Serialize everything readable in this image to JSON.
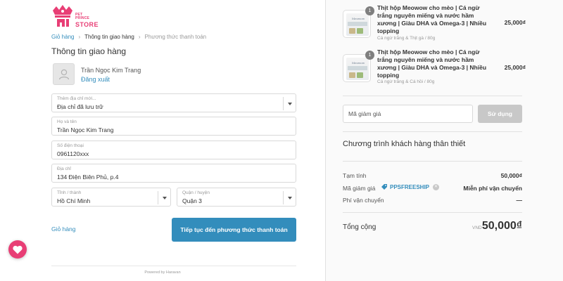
{
  "logo": {
    "line1": "PET",
    "line2": "PRINCE",
    "line3": "STORE"
  },
  "breadcrumb": {
    "cart": "Giỏ hàng",
    "shipping_info": "Thông tin giao hàng",
    "payment_method": "Phương thức thanh toán"
  },
  "section_title": "Thông tin giao hàng",
  "user": {
    "name": "Trần Ngọc Kim Trang",
    "logout": "Đăng xuất"
  },
  "fields": {
    "address_select": {
      "label": "Thêm địa chỉ mới...",
      "value": "Địa chỉ đã lưu trữ"
    },
    "fullname": {
      "label": "Họ và tên",
      "value": "Trần Ngọc Kim Trang"
    },
    "phone": {
      "label": "Số điện thoại",
      "value": "0961120xxx"
    },
    "address": {
      "label": "Địa chỉ",
      "value": "134 Điện Biên Phủ, p.4"
    },
    "province": {
      "label": "Tỉnh / thành",
      "value": "Hồ Chí Minh"
    },
    "district": {
      "label": "Quận / huyện",
      "value": "Quận 3"
    }
  },
  "actions": {
    "back_to_cart": "Giỏ hàng",
    "continue": "Tiếp tục đến phương thức thanh toán"
  },
  "footer": {
    "powered": "Powered by Haravan"
  },
  "products": [
    {
      "qty": "1",
      "name": "Thịt hộp Meowow cho mèo | Cá ngừ trắng nguyên miếng và nước hầm xương | Giàu DHA và Omega-3 | Nhiều topping",
      "variant": "Cá ngừ trắng & Thịt gà / 80g",
      "price": "25,000₫",
      "thumb_text": "Meowow"
    },
    {
      "qty": "1",
      "name": "Thịt hộp Meowow cho mèo | Cá ngừ trắng nguyên miếng và nước hầm xương | Giàu DHA và Omega-3 | Nhiều topping",
      "variant": "Cá ngừ trắng & Cá hồi / 80g",
      "price": "25,000₫",
      "thumb_text": "Meowow"
    }
  ],
  "discount": {
    "placeholder": "Mã giảm giá",
    "apply": "Sử dụng"
  },
  "loyalty_title": "Chương trình khách hàng thân thiết",
  "summary": {
    "subtotal_label": "Tạm tính",
    "subtotal_value": "50,000₫",
    "discount_label": "Mã giảm giá",
    "discount_code": "PPSFREESHIP",
    "discount_value": "Miễn phí vận chuyển",
    "shipping_label": "Phí vận chuyển",
    "shipping_value": "—",
    "total_label": "Tổng cộng",
    "currency": "VND",
    "total_value": "50,000₫"
  },
  "colors": {
    "accent": "#338dbc",
    "brand": "#e83e75",
    "button_disabled": "#c8c8c8"
  }
}
